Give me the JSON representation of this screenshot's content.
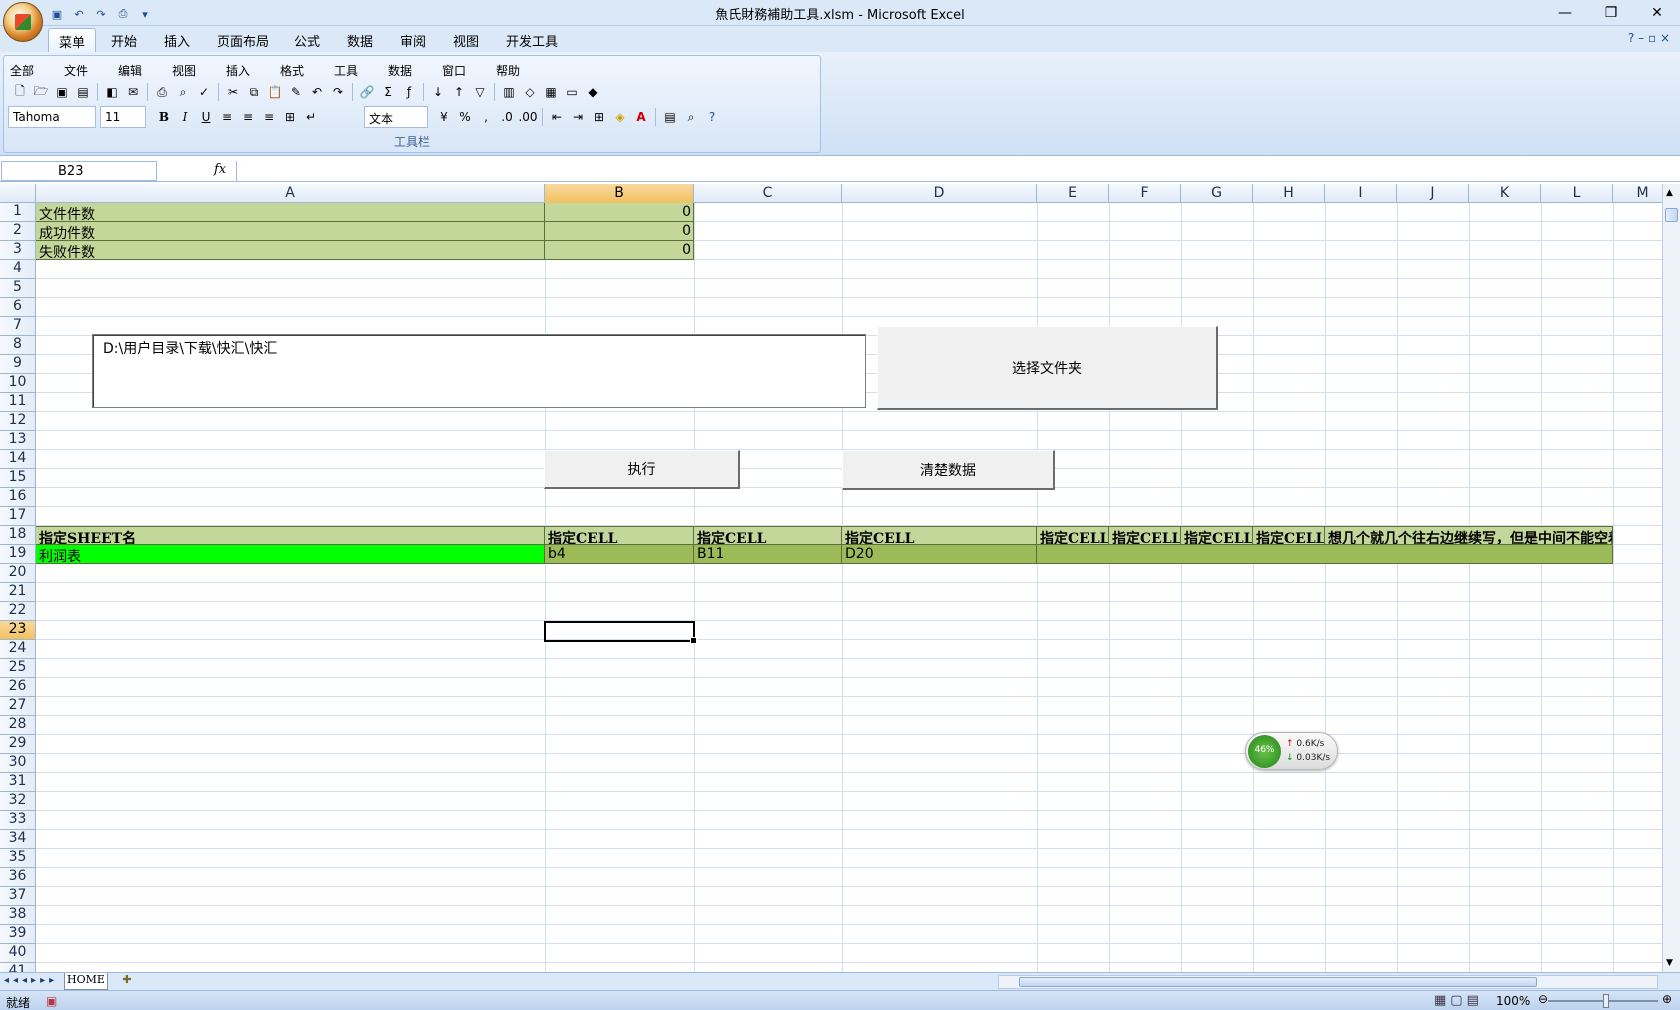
{
  "window": {
    "title": "魚氏財務補助工具.xlsm - Microsoft Excel",
    "controls": [
      "—",
      "❐",
      "✕"
    ]
  },
  "ribbon_tabs": [
    "菜单",
    "开始",
    "插入",
    "页面布局",
    "公式",
    "数据",
    "审阅",
    "视图",
    "开发工具"
  ],
  "menu_items": [
    "全部",
    "文件",
    "编辑",
    "视图",
    "插入",
    "格式",
    "工具",
    "数据",
    "窗口",
    "帮助"
  ],
  "toolbar": {
    "font": "Tahoma",
    "size": "11",
    "numfmt": "文本",
    "group_label": "工具栏"
  },
  "formula_bar": {
    "namebox": "B23",
    "fx": "fx",
    "value": ""
  },
  "columns": [
    "A",
    "B",
    "C",
    "D",
    "E",
    "F",
    "G",
    "H",
    "I",
    "J",
    "K",
    "L",
    "M"
  ],
  "rows": [
    "1",
    "2",
    "3",
    "4",
    "5",
    "6",
    "7",
    "8",
    "9",
    "10",
    "11",
    "12",
    "13",
    "14",
    "15",
    "16",
    "17",
    "18",
    "19",
    "20",
    "21",
    "22",
    "23",
    "24",
    "25",
    "26",
    "27",
    "28",
    "29",
    "30",
    "31",
    "32",
    "33",
    "34",
    "35",
    "36",
    "37",
    "38",
    "39",
    "40",
    "41"
  ],
  "summary": [
    {
      "label": "文件件数",
      "value": "0"
    },
    {
      "label": "成功件数",
      "value": "0"
    },
    {
      "label": "失败件数",
      "value": "0"
    }
  ],
  "path_box": "D:\\用户目录\\下载\\快汇\\快汇",
  "buttons": {
    "select_folder": "选择文件夹",
    "execute": "执行",
    "clear": "清楚数据"
  },
  "header_row": [
    "指定SHEET名",
    "指定CELL",
    "指定CELL",
    "指定CELL",
    "指定CELL",
    "指定CELL",
    "指定CELL",
    "指定CELL",
    "想几个就几个往右边继续写，但是中间不能空着"
  ],
  "data_row": [
    "利润表",
    "b4",
    "B11",
    "D20"
  ],
  "net_widget": {
    "percent": "46%",
    "up": "0.6K/s",
    "down": "0.03K/s"
  },
  "sheet_tab": "HOME",
  "status": {
    "text": "就绪",
    "zoom": "100%"
  }
}
